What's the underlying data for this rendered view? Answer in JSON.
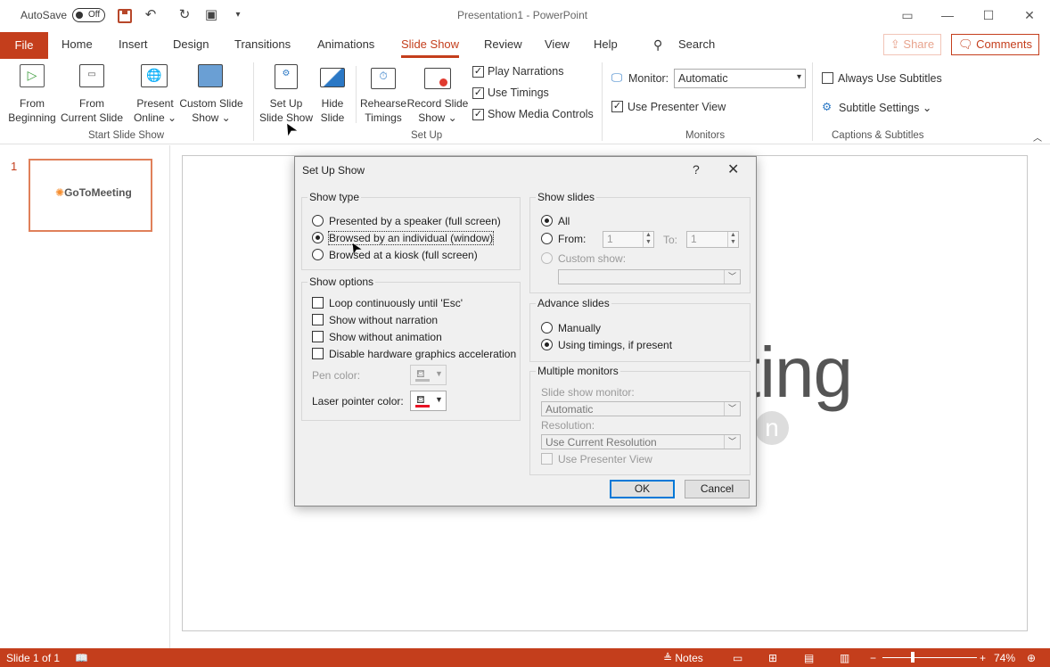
{
  "titlebar": {
    "autosave_label": "AutoSave",
    "autosave_state": "Off",
    "title": "Presentation1  -  PowerPoint"
  },
  "tabs": [
    "File",
    "Home",
    "Insert",
    "Design",
    "Transitions",
    "Animations",
    "Slide Show",
    "Review",
    "View",
    "Help"
  ],
  "tab_search": "Search",
  "share_label": "Share",
  "comments_label": "Comments",
  "ribbon": {
    "start": {
      "from_beginning": [
        "From",
        "Beginning"
      ],
      "from_current": [
        "From",
        "Current Slide"
      ],
      "present_online": [
        "Present",
        "Online"
      ],
      "custom_show": [
        "Custom Slide",
        "Show"
      ],
      "group": "Start Slide Show"
    },
    "setup": {
      "setup_show": [
        "Set Up",
        "Slide Show"
      ],
      "hide_slide": [
        "Hide",
        "Slide"
      ],
      "rehearse": [
        "Rehearse",
        "Timings"
      ],
      "record": [
        "Record Slide",
        "Show"
      ],
      "play_narrations": "Play Narrations",
      "use_timings": "Use Timings",
      "show_media": "Show Media Controls",
      "group": "Set Up"
    },
    "monitors": {
      "monitor_label": "Monitor:",
      "monitor_value": "Automatic",
      "presenter_view": "Use Presenter View",
      "group": "Monitors"
    },
    "captions": {
      "always_subtitles": "Always Use Subtitles",
      "subtitle_settings": "Subtitle Settings",
      "group": "Captions & Subtitles"
    }
  },
  "thumbs": {
    "slide_number": "1",
    "logo_text": "GoToMeeting"
  },
  "slide": {
    "big_text": "ting"
  },
  "dialog": {
    "title": "Set Up Show",
    "help": "?",
    "show_type": {
      "legend": "Show type",
      "options": [
        "Presented by a speaker (full screen)",
        "Browsed by an individual (window)",
        "Browsed at a kiosk (full screen)"
      ],
      "selected": 1
    },
    "show_options": {
      "legend": "Show options",
      "checks": [
        "Loop continuously until 'Esc'",
        "Show without narration",
        "Show without animation",
        "Disable hardware graphics acceleration"
      ],
      "pen_color": "Pen color:",
      "laser_color": "Laser pointer color:",
      "laser_hex": "#e81123"
    },
    "show_slides": {
      "legend": "Show slides",
      "all": "All",
      "from": "From:",
      "from_value": "1",
      "to": "To:",
      "to_value": "1",
      "custom": "Custom show:"
    },
    "advance": {
      "legend": "Advance slides",
      "manually": "Manually",
      "using_timings": "Using timings, if present"
    },
    "multi": {
      "legend": "Multiple monitors",
      "monitor_label": "Slide show monitor:",
      "monitor_value": "Automatic",
      "resolution_label": "Resolution:",
      "resolution_value": "Use Current Resolution",
      "presenter_view": "Use Presenter View"
    },
    "ok": "OK",
    "cancel": "Cancel"
  },
  "status": {
    "slide_of": "Slide 1 of 1",
    "notes": "Notes",
    "zoom": "74%"
  },
  "colors": {
    "accent": "#c43e1c"
  }
}
